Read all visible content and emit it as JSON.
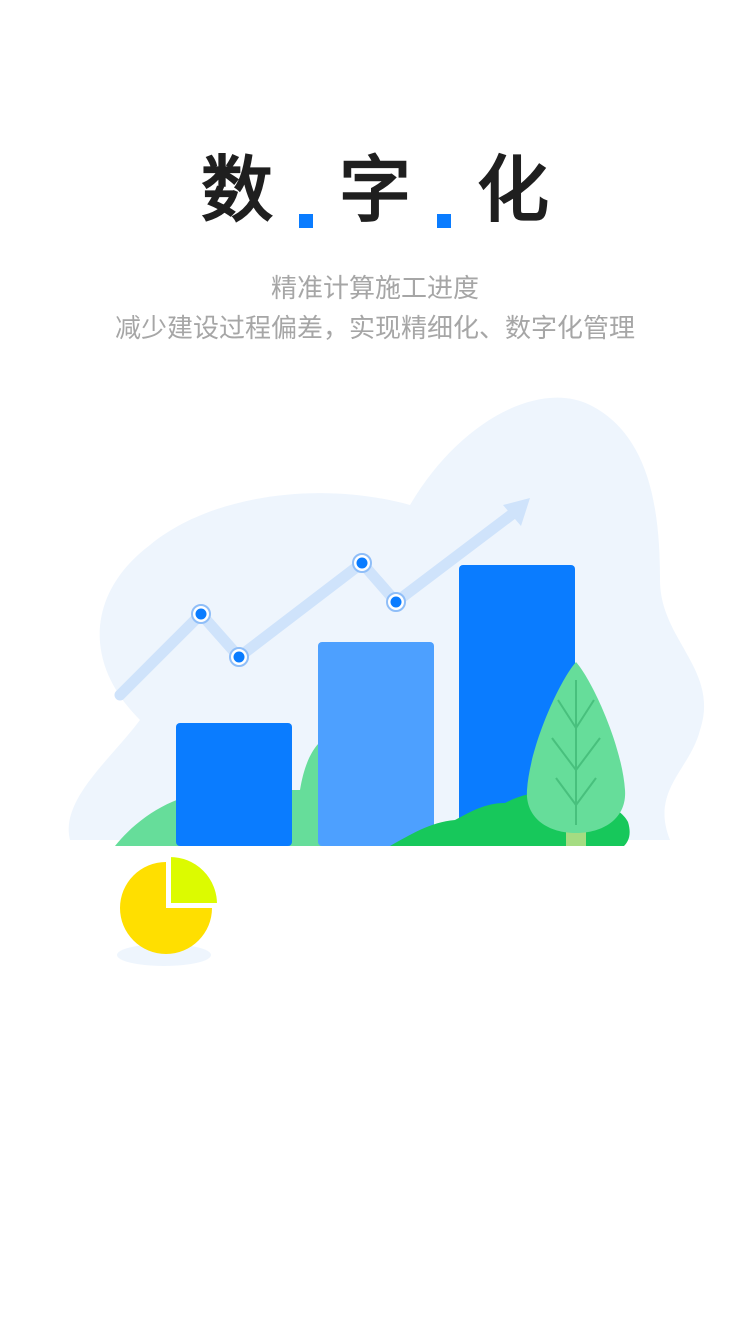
{
  "header": {
    "title_chars": [
      "数",
      "字",
      "化"
    ]
  },
  "intro": {
    "line1": "精准计算施工进度",
    "line2": "减少建设过程偏差，实现精细化、数字化管理"
  },
  "colors": {
    "accent": "#0a7cff",
    "bar_light": "#4da0ff",
    "blob": "#eef5fd",
    "trend_line": "#cfe3fb",
    "green_dark": "#17c85b",
    "green_light": "#66dd9a",
    "pie_yellow": "#ffdf00",
    "pie_lime": "#dcfb00",
    "title_text": "#1f1f1f",
    "subtitle_text": "#a6a6a6"
  },
  "icons": {
    "illustration": "growth-chart-illustration",
    "tree": "tree-icon",
    "pie": "pie-chart-icon"
  }
}
